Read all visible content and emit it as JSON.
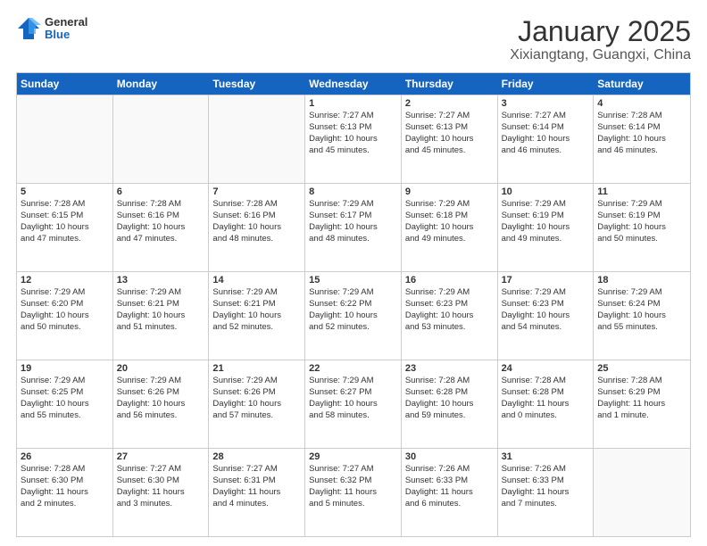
{
  "logo": {
    "general": "General",
    "blue": "Blue"
  },
  "title": "January 2025",
  "subtitle": "Xixiangtang, Guangxi, China",
  "days": [
    "Sunday",
    "Monday",
    "Tuesday",
    "Wednesday",
    "Thursday",
    "Friday",
    "Saturday"
  ],
  "weeks": [
    [
      {
        "day": "",
        "info": ""
      },
      {
        "day": "",
        "info": ""
      },
      {
        "day": "",
        "info": ""
      },
      {
        "day": "1",
        "info": "Sunrise: 7:27 AM\nSunset: 6:13 PM\nDaylight: 10 hours\nand 45 minutes."
      },
      {
        "day": "2",
        "info": "Sunrise: 7:27 AM\nSunset: 6:13 PM\nDaylight: 10 hours\nand 45 minutes."
      },
      {
        "day": "3",
        "info": "Sunrise: 7:27 AM\nSunset: 6:14 PM\nDaylight: 10 hours\nand 46 minutes."
      },
      {
        "day": "4",
        "info": "Sunrise: 7:28 AM\nSunset: 6:14 PM\nDaylight: 10 hours\nand 46 minutes."
      }
    ],
    [
      {
        "day": "5",
        "info": "Sunrise: 7:28 AM\nSunset: 6:15 PM\nDaylight: 10 hours\nand 47 minutes."
      },
      {
        "day": "6",
        "info": "Sunrise: 7:28 AM\nSunset: 6:16 PM\nDaylight: 10 hours\nand 47 minutes."
      },
      {
        "day": "7",
        "info": "Sunrise: 7:28 AM\nSunset: 6:16 PM\nDaylight: 10 hours\nand 48 minutes."
      },
      {
        "day": "8",
        "info": "Sunrise: 7:29 AM\nSunset: 6:17 PM\nDaylight: 10 hours\nand 48 minutes."
      },
      {
        "day": "9",
        "info": "Sunrise: 7:29 AM\nSunset: 6:18 PM\nDaylight: 10 hours\nand 49 minutes."
      },
      {
        "day": "10",
        "info": "Sunrise: 7:29 AM\nSunset: 6:19 PM\nDaylight: 10 hours\nand 49 minutes."
      },
      {
        "day": "11",
        "info": "Sunrise: 7:29 AM\nSunset: 6:19 PM\nDaylight: 10 hours\nand 50 minutes."
      }
    ],
    [
      {
        "day": "12",
        "info": "Sunrise: 7:29 AM\nSunset: 6:20 PM\nDaylight: 10 hours\nand 50 minutes."
      },
      {
        "day": "13",
        "info": "Sunrise: 7:29 AM\nSunset: 6:21 PM\nDaylight: 10 hours\nand 51 minutes."
      },
      {
        "day": "14",
        "info": "Sunrise: 7:29 AM\nSunset: 6:21 PM\nDaylight: 10 hours\nand 52 minutes."
      },
      {
        "day": "15",
        "info": "Sunrise: 7:29 AM\nSunset: 6:22 PM\nDaylight: 10 hours\nand 52 minutes."
      },
      {
        "day": "16",
        "info": "Sunrise: 7:29 AM\nSunset: 6:23 PM\nDaylight: 10 hours\nand 53 minutes."
      },
      {
        "day": "17",
        "info": "Sunrise: 7:29 AM\nSunset: 6:23 PM\nDaylight: 10 hours\nand 54 minutes."
      },
      {
        "day": "18",
        "info": "Sunrise: 7:29 AM\nSunset: 6:24 PM\nDaylight: 10 hours\nand 55 minutes."
      }
    ],
    [
      {
        "day": "19",
        "info": "Sunrise: 7:29 AM\nSunset: 6:25 PM\nDaylight: 10 hours\nand 55 minutes."
      },
      {
        "day": "20",
        "info": "Sunrise: 7:29 AM\nSunset: 6:26 PM\nDaylight: 10 hours\nand 56 minutes."
      },
      {
        "day": "21",
        "info": "Sunrise: 7:29 AM\nSunset: 6:26 PM\nDaylight: 10 hours\nand 57 minutes."
      },
      {
        "day": "22",
        "info": "Sunrise: 7:29 AM\nSunset: 6:27 PM\nDaylight: 10 hours\nand 58 minutes."
      },
      {
        "day": "23",
        "info": "Sunrise: 7:28 AM\nSunset: 6:28 PM\nDaylight: 10 hours\nand 59 minutes."
      },
      {
        "day": "24",
        "info": "Sunrise: 7:28 AM\nSunset: 6:28 PM\nDaylight: 11 hours\nand 0 minutes."
      },
      {
        "day": "25",
        "info": "Sunrise: 7:28 AM\nSunset: 6:29 PM\nDaylight: 11 hours\nand 1 minute."
      }
    ],
    [
      {
        "day": "26",
        "info": "Sunrise: 7:28 AM\nSunset: 6:30 PM\nDaylight: 11 hours\nand 2 minutes."
      },
      {
        "day": "27",
        "info": "Sunrise: 7:27 AM\nSunset: 6:30 PM\nDaylight: 11 hours\nand 3 minutes."
      },
      {
        "day": "28",
        "info": "Sunrise: 7:27 AM\nSunset: 6:31 PM\nDaylight: 11 hours\nand 4 minutes."
      },
      {
        "day": "29",
        "info": "Sunrise: 7:27 AM\nSunset: 6:32 PM\nDaylight: 11 hours\nand 5 minutes."
      },
      {
        "day": "30",
        "info": "Sunrise: 7:26 AM\nSunset: 6:33 PM\nDaylight: 11 hours\nand 6 minutes."
      },
      {
        "day": "31",
        "info": "Sunrise: 7:26 AM\nSunset: 6:33 PM\nDaylight: 11 hours\nand 7 minutes."
      },
      {
        "day": "",
        "info": ""
      }
    ]
  ]
}
